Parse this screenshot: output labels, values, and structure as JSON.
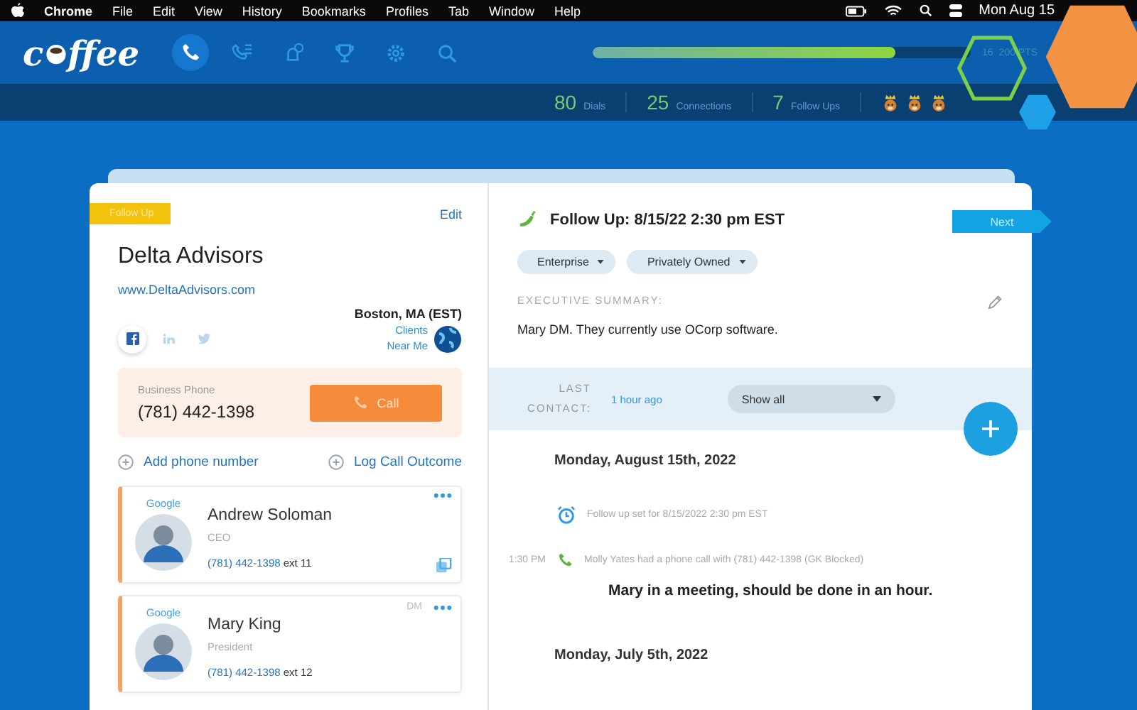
{
  "menubar": {
    "app": "Chrome",
    "menus": [
      "File",
      "Edit",
      "View",
      "History",
      "Bookmarks",
      "Profiles",
      "Tab",
      "Window",
      "Help"
    ],
    "clock": "Mon Aug 15"
  },
  "header": {
    "logo": [
      "c",
      "ffee"
    ],
    "nav": [
      {
        "kind": "phone",
        "selected": true
      },
      {
        "kind": "phone-list",
        "selected": false
      },
      {
        "kind": "bell-clock",
        "selected": false
      },
      {
        "kind": "trophy",
        "selected": false
      },
      {
        "kind": "gear",
        "selected": false
      },
      {
        "kind": "search",
        "selected": false
      }
    ],
    "progress": {
      "level": 0.8
    },
    "points": "16",
    "points_goal": "200 PTS"
  },
  "stats": [
    {
      "value": "80",
      "label": "Dials"
    },
    {
      "value": "25",
      "label": "Connections"
    },
    {
      "value": "7",
      "label": "Follow Ups"
    }
  ],
  "account": {
    "tag": "Follow Up",
    "edit": "Edit",
    "name": "Delta Advisors",
    "url": "www.DeltaAdvisors.com",
    "location": "Boston, MA (EST)",
    "nearby": "Clients Near Me",
    "social": [
      {
        "kind": "facebook",
        "active": true
      },
      {
        "kind": "linkedin",
        "active": false
      },
      {
        "kind": "twitter",
        "active": false
      }
    ],
    "phone": {
      "label": "Business Phone",
      "number": "(781) 442-1398",
      "call": "Call"
    },
    "actions": [
      "Add phone number",
      "Log Call Outcome"
    ]
  },
  "contacts": [
    {
      "source": "Google",
      "name": "Andrew Soloman",
      "title": "CEO",
      "phone": "(781) 442-1398",
      "ext": "ext 11"
    },
    {
      "source": "Google",
      "role_tag": "DM",
      "name": "Mary King",
      "title": "President",
      "phone": "(781) 442-1398",
      "ext": "ext 12"
    }
  ],
  "detail": {
    "title": "Follow Up: 8/15/22 2:30 pm EST",
    "next": "Next",
    "tags": [
      "Enterprise",
      "Privately Owned"
    ],
    "summary_label": "EXECUTIVE SUMMARY:",
    "summary": "Mary DM. They currently use OCorp software.",
    "last_contact_label": "LAST CONTACT:",
    "last_contact": "1 hour ago",
    "filter": "Show all",
    "timeline": [
      {
        "kind": "date",
        "text": "Monday, August 15th, 2022"
      },
      {
        "kind": "alarm",
        "text": "Follow up set for 8/15/2022 2:30 pm EST"
      },
      {
        "kind": "call",
        "time": "1:30 PM",
        "text": "Molly Yates had a phone call with (781) 442-1398 (GK Blocked)"
      },
      {
        "kind": "note",
        "text": "Mary in a meeting, should be done in an hour."
      },
      {
        "kind": "date",
        "text": "Monday, July 5th, 2022"
      }
    ]
  }
}
